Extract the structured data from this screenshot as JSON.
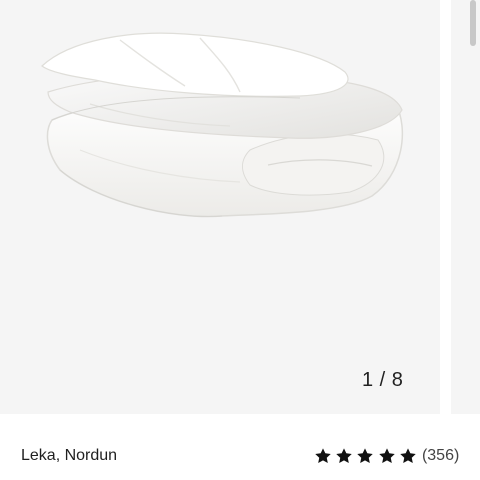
{
  "gallery": {
    "image_alt": "White folded duvet",
    "counter": "1 / 8"
  },
  "product": {
    "title": "Leka, Nordun",
    "rating": 5,
    "rating_max": 5,
    "review_count": "(356)"
  },
  "colors": {
    "gallery_background": "#f5f5f5",
    "star": "#111111",
    "text": "#1f1f1f"
  },
  "icons": {
    "star": "star-icon"
  }
}
